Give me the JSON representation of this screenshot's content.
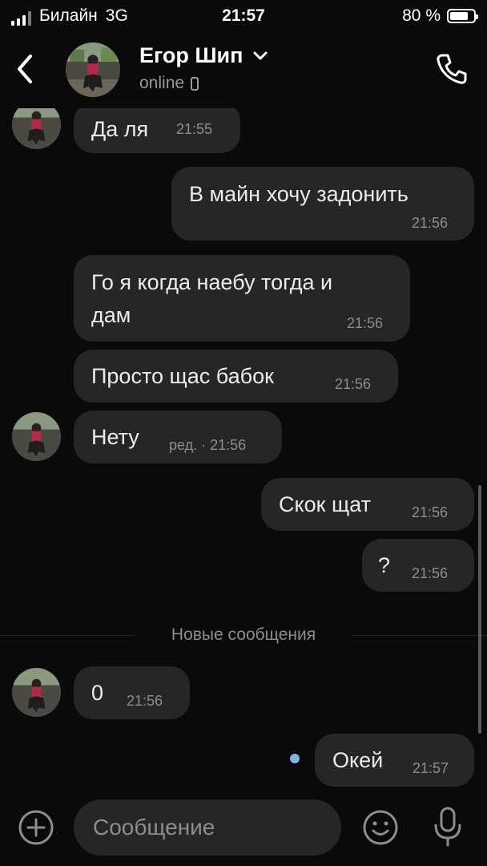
{
  "status_bar": {
    "carrier": "Билайн",
    "network": "3G",
    "time": "21:57",
    "battery": "80 %",
    "battery_level": 0.8
  },
  "header": {
    "name": "Егор Шип",
    "status": "online",
    "back_icon": "chevron-left-icon",
    "call_icon": "phone-icon"
  },
  "messages": [
    {
      "text": "Да ля",
      "time": "21:55",
      "direction": "in"
    },
    {
      "text": "В майн хочу задонить",
      "time": "21:56",
      "direction": "out"
    },
    {
      "text_line1": "Го я когда наебу тогда и",
      "text_line2": "дам",
      "time": "21:56",
      "direction": "in"
    },
    {
      "text": "Просто щас бабок",
      "time": "21:56",
      "direction": "in"
    },
    {
      "text": "Нету",
      "time": "ред. · 21:56",
      "direction": "in"
    },
    {
      "text": "Скок щат",
      "time": "21:56",
      "direction": "out"
    },
    {
      "text": "?",
      "time": "21:56",
      "direction": "out"
    },
    {
      "text": "0",
      "time": "21:56",
      "direction": "in"
    },
    {
      "text": "Окей",
      "time": "21:57",
      "direction": "out",
      "unread": true
    }
  ],
  "divider_label": "Новые сообщения",
  "composer": {
    "placeholder": "Сообщение",
    "attach_icon": "plus-circle-icon",
    "emoji_icon": "smile-icon",
    "mic_icon": "microphone-icon"
  },
  "colors": {
    "background": "#0a0a0a",
    "bubble": "#262628",
    "unread_dot": "#8ab0e8",
    "secondary_text": "#8d8d8d"
  }
}
